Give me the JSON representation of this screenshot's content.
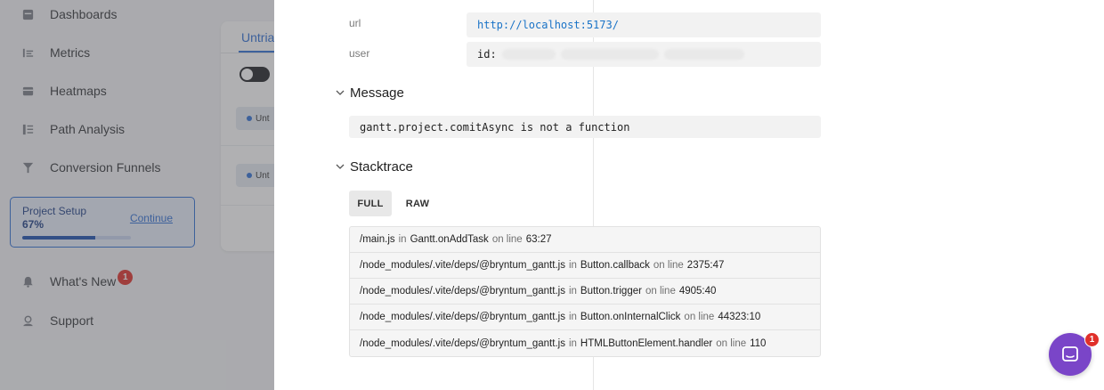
{
  "sidebar": {
    "items": [
      {
        "label": "Dashboards",
        "icon": "dashboard-icon"
      },
      {
        "label": "Metrics",
        "icon": "metrics-icon"
      },
      {
        "label": "Heatmaps",
        "icon": "heatmap-icon"
      },
      {
        "label": "Path Analysis",
        "icon": "path-icon"
      },
      {
        "label": "Conversion Funnels",
        "icon": "funnel-icon"
      }
    ],
    "setup": {
      "title": "Project Setup",
      "percent": "67%",
      "progress": 0.67,
      "link": "Continue"
    },
    "whats_new": {
      "label": "What's New",
      "badge": "1"
    },
    "support": {
      "label": "Support"
    }
  },
  "bg_panel": {
    "tab": "Untria",
    "row1": "Unt",
    "row2": "Unt"
  },
  "details": {
    "url_key": "url",
    "url_value": "http://localhost:5173/",
    "user_key": "user",
    "user_value": "id:"
  },
  "message": {
    "heading": "Message",
    "text": "gantt.project.comitAsync is not a function"
  },
  "stacktrace": {
    "heading": "Stacktrace",
    "tabs": {
      "full": "FULL",
      "raw": "RAW"
    },
    "frames": [
      {
        "file": "/main.js",
        "in": "in",
        "fn": "Gantt.onAddTask",
        "on": "on line",
        "line": "63:27"
      },
      {
        "file": "/node_modules/.vite/deps/@bryntum_gantt.js",
        "in": "in",
        "fn": "Button.callback",
        "on": "on line",
        "line": "2375:47"
      },
      {
        "file": "/node_modules/.vite/deps/@bryntum_gantt.js",
        "in": "in",
        "fn": "Button.trigger",
        "on": "on line",
        "line": "4905:40"
      },
      {
        "file": "/node_modules/.vite/deps/@bryntum_gantt.js",
        "in": "in",
        "fn": "Button.onInternalClick",
        "on": "on line",
        "line": "44323:10"
      },
      {
        "file": "/node_modules/.vite/deps/@bryntum_gantt.js",
        "in": "in",
        "fn": "HTMLButtonElement.handler",
        "on": "on line",
        "line": "110"
      }
    ]
  },
  "chat": {
    "badge": "1",
    "color": "#7a45c8"
  }
}
